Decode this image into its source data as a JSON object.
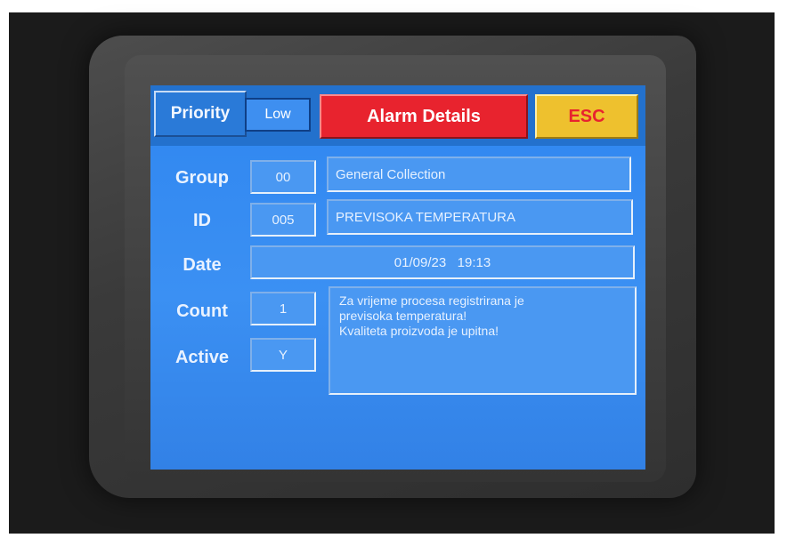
{
  "header": {
    "priority_label": "Priority",
    "priority_value": "Low",
    "title": "Alarm Details",
    "esc_label": "ESC"
  },
  "fields": {
    "group": {
      "label": "Group",
      "code": "00",
      "name": "General Collection"
    },
    "id": {
      "label": "ID",
      "code": "005",
      "name": "PREVISOKA TEMPERATURA"
    },
    "date": {
      "label": "Date",
      "value": "01/09/23   19:13"
    },
    "count": {
      "label": "Count",
      "value": "1"
    },
    "active": {
      "label": "Active",
      "value": "Y"
    }
  },
  "message": {
    "lines": [
      "Za vrijeme procesa registrirana je",
      "previsoka temperatura!",
      "Kvaliteta proizvoda je upitna!"
    ]
  },
  "colors": {
    "screen_blue": "#2f86f0",
    "alarm_red": "#e8232e",
    "esc_yellow": "#eec12e"
  }
}
